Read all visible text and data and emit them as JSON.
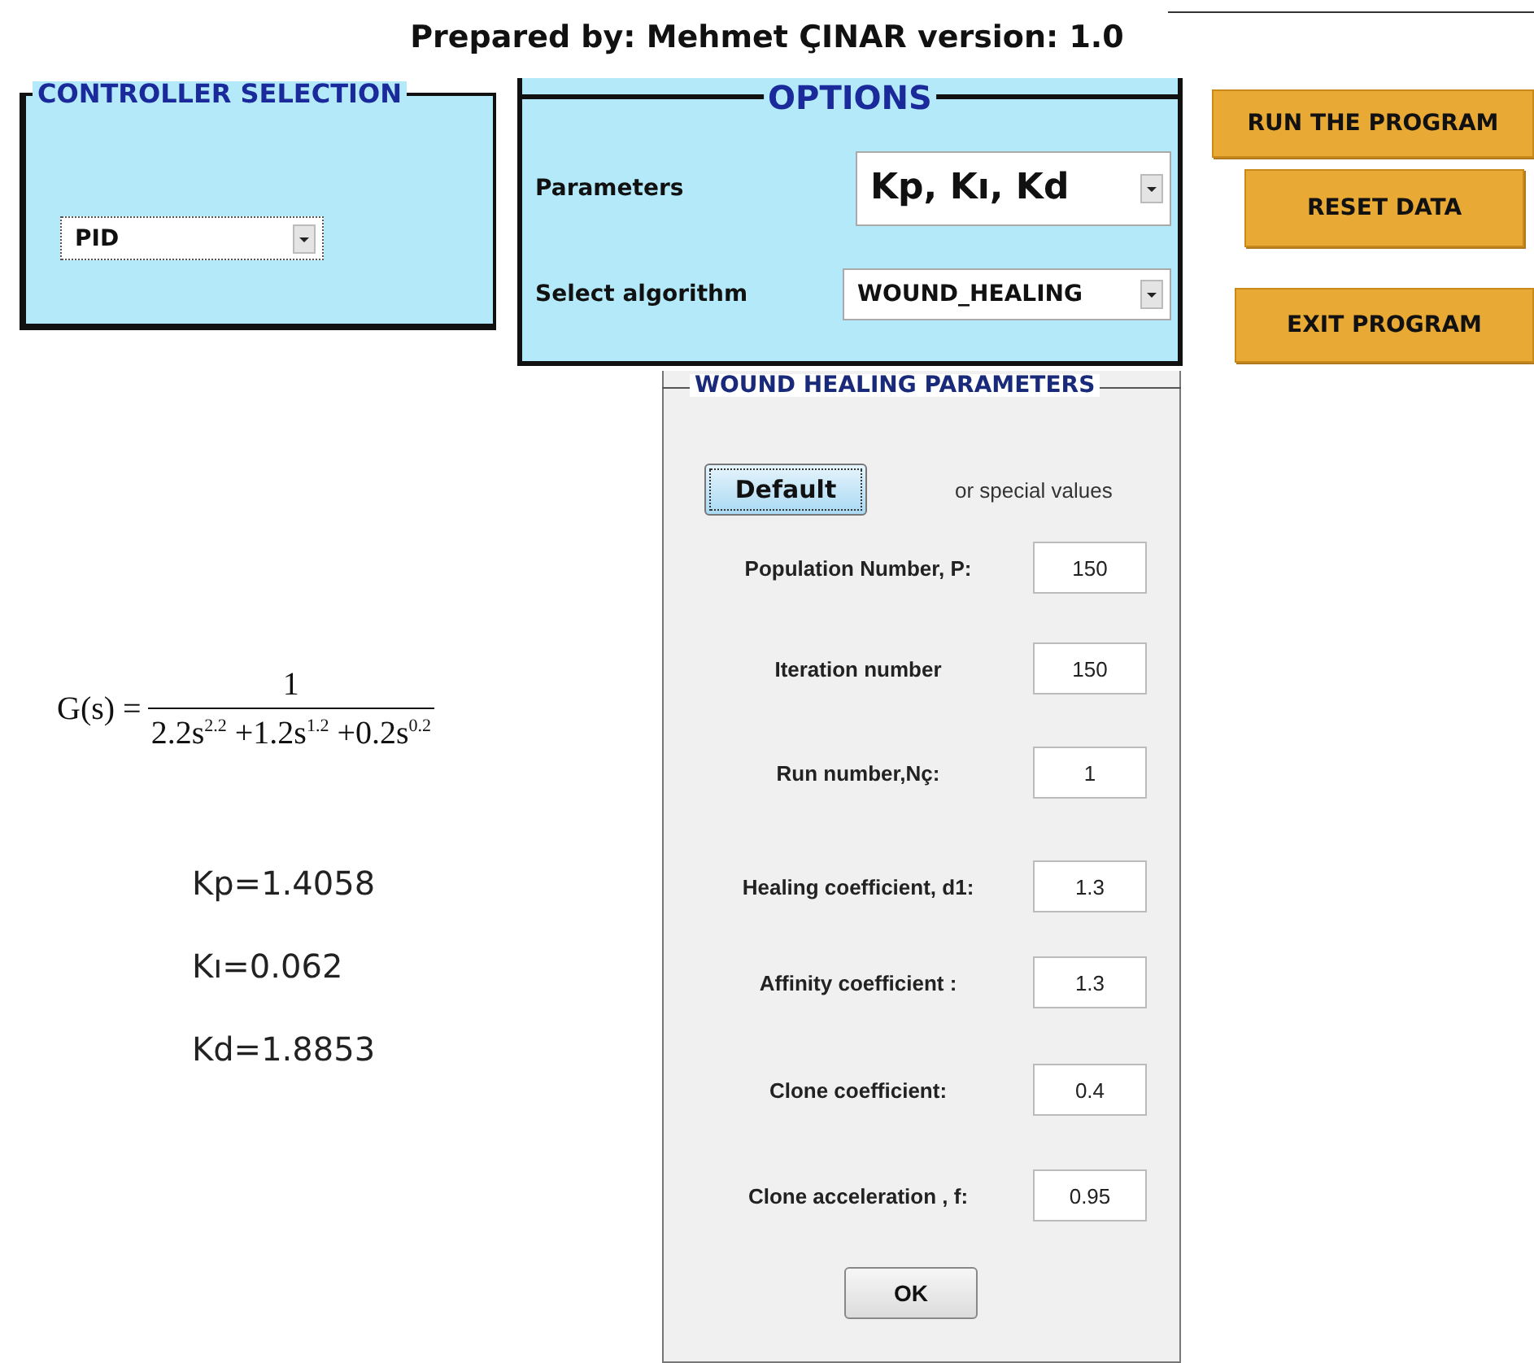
{
  "header": {
    "title": "Prepared by: Mehmet ÇINAR version: 1.0"
  },
  "controller_selection": {
    "title": "CONTROLLER SELECTION",
    "dropdown": {
      "value": "PID"
    }
  },
  "options": {
    "title": "OPTIONS",
    "fields": [
      {
        "label": "Parameters",
        "value": "Kp, Kı, Kd",
        "kind": "large"
      },
      {
        "label": "Select algorithm",
        "value": "WOUND_HEALING",
        "kind": "normal"
      }
    ]
  },
  "buttons": [
    {
      "label": "RUN THE PROGRAM"
    },
    {
      "label": "RESET DATA"
    },
    {
      "label": "EXIT PROGRAM"
    }
  ],
  "formula": {
    "lhs": "G(s) =",
    "numerator": "1",
    "denominator": "2.2s$^{2.2}$ +1.2s$^{1.2}$ +0.2s$^{0.2}$"
  },
  "results": [
    "Kp=1.4058",
    "Kı=0.062",
    "Kd=1.8853"
  ],
  "wound_healing": {
    "title": "WOUND HEALING PARAMETERS",
    "default_button": "Default",
    "hint": "or special values",
    "params": [
      {
        "label": "Population Number, P:",
        "value": "150"
      },
      {
        "label": "Iteration number",
        "value": "150"
      },
      {
        "label": "Run number,Nç:",
        "value": "1"
      },
      {
        "label": "Healing coefficient, d1:",
        "value": "1.3"
      },
      {
        "label": "Affinity coefficient :",
        "value": "1.3"
      },
      {
        "label": "Clone coefficient:",
        "value": "0.4"
      },
      {
        "label": "Clone acceleration , f:",
        "value": "0.95"
      }
    ],
    "ok_button": "OK"
  }
}
